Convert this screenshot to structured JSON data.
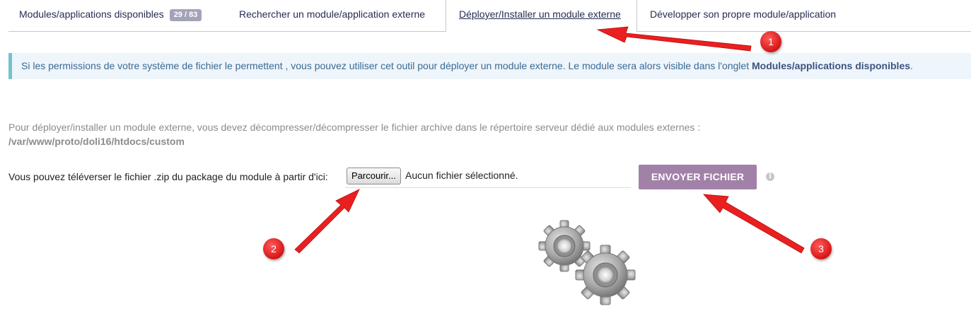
{
  "tabs": [
    {
      "label": "Modules/applications disponibles",
      "badge": "29 / 83"
    },
    {
      "label": "Rechercher un module/application externe"
    },
    {
      "label": "Déployer/Installer un module externe"
    },
    {
      "label": "Développer son propre module/application"
    }
  ],
  "info": {
    "text": "Si les permissions de votre système de fichier le permettent , vous pouvez utiliser cet outil pour déployer un module externe. Le module sera alors visible dans l'onglet ",
    "bold": "Modules/applications disponibles",
    "end": "."
  },
  "instructions": {
    "line1": "Pour déployer/installer un module externe, vous devez décompresser/décompresser le fichier archive dans le répertoire serveur dédié aux modules externes :",
    "path": "/var/www/proto/doli16/htdocs/custom"
  },
  "upload": {
    "label": "Vous pouvez téléverser le fichier .zip du package du module à partir d'ici:",
    "browse": "Parcourir...",
    "no_file": "Aucun fichier sélectionné.",
    "send": "ENVOYER FICHIER",
    "info_glyph": "i"
  },
  "annotations": {
    "markers": [
      "1",
      "2",
      "3"
    ],
    "color": "#e52222"
  },
  "colors": {
    "tab_text": "#262c52",
    "info_bg": "#eef5fb",
    "info_border": "#74c3cd",
    "send_button": "#a281a8",
    "badge": "#a3a3b8"
  }
}
